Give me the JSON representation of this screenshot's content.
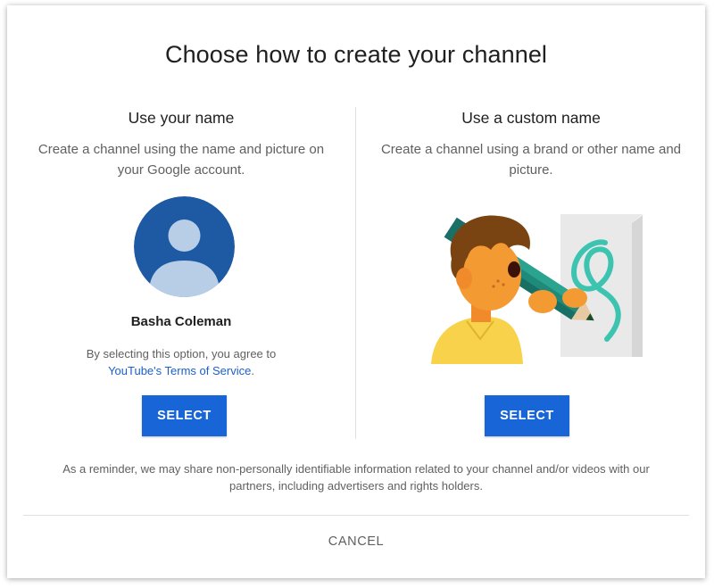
{
  "dialog": {
    "title": "Choose how to create your channel",
    "left": {
      "heading": "Use your name",
      "description": "Create a channel using the name and picture on your Google account.",
      "user_name": "Basha Coleman",
      "agree_text": "By selecting this option, you agree to",
      "tos_link": "YouTube's Terms of Service",
      "tos_suffix": ".",
      "select_label": "SELECT"
    },
    "right": {
      "heading": "Use a custom name",
      "description": "Create a channel using a brand or other name and picture.",
      "select_label": "SELECT"
    },
    "reminder": "As a reminder, we may share non-personally identifiable information related to your channel and/or videos with our partners, including advertisers and rights holders.",
    "cancel_label": "CANCEL"
  },
  "icons": {
    "avatar": "default-user-avatar-icon",
    "illustration": "person-drawing-with-giant-pencil-illustration"
  },
  "colors": {
    "primary_button": "#1765d6",
    "link": "#1a5fd0",
    "avatar_bg": "#1d5aa3",
    "avatar_figure": "#b8cee6"
  }
}
